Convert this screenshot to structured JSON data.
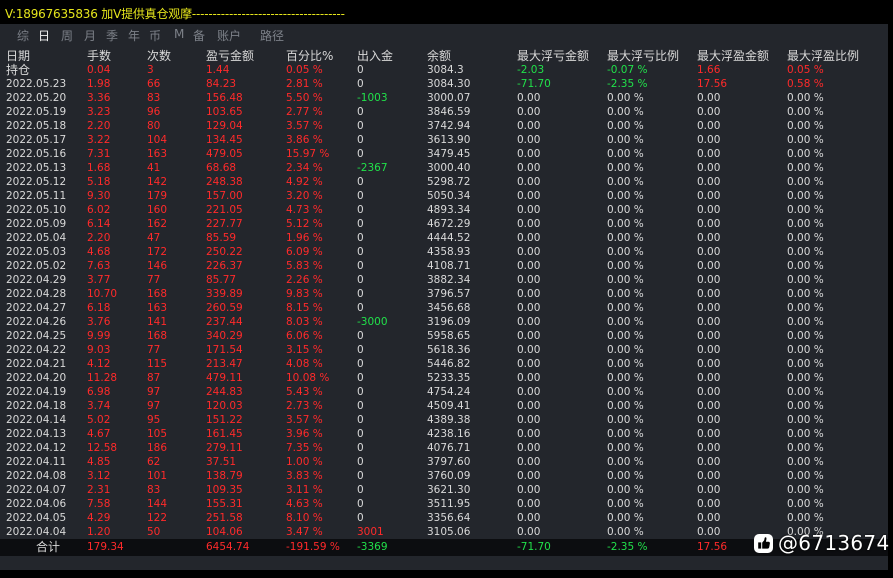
{
  "title": "V:18967635836 加V提供真仓观摩-------------------------------------",
  "tabs": [
    {
      "label": "综",
      "active": false
    },
    {
      "label": "日",
      "active": true
    },
    {
      "label": "周",
      "active": false
    },
    {
      "label": "月",
      "active": false
    },
    {
      "label": "季",
      "active": false
    },
    {
      "label": "年",
      "active": false
    },
    {
      "label": "币",
      "active": false
    },
    {
      "label": "M",
      "active": false
    },
    {
      "label": "备",
      "active": false
    },
    {
      "label": "账户",
      "active": false
    },
    {
      "label": "路径",
      "active": false
    }
  ],
  "columns": [
    "日期",
    "手数",
    "次数",
    "盈亏金额",
    "百分比%",
    "出入金",
    "余额",
    "最大浮亏金额",
    "最大浮亏比例",
    "最大浮盈金额",
    "最大浮盈比例"
  ],
  "colors": {
    "positive": "#ff2a2a",
    "negative": "#21e04a",
    "neutral": "#d9d9d9",
    "title": "#e6e61c"
  },
  "rows": [
    [
      "持仓",
      "0.04",
      "3",
      "1.44",
      "0.05 %",
      "0",
      "3084.3",
      "-2.03",
      "-0.07 %",
      "1.66",
      "0.05 %"
    ],
    [
      "2022.05.23",
      "1.98",
      "66",
      "84.23",
      "2.81 %",
      "0",
      "3084.30",
      "-71.70",
      "-2.35 %",
      "17.56",
      "0.58 %"
    ],
    [
      "2022.05.20",
      "3.36",
      "83",
      "156.48",
      "5.50 %",
      "-1003",
      "3000.07",
      "0.00",
      "0.00 %",
      "0.00",
      "0.00 %"
    ],
    [
      "2022.05.19",
      "3.23",
      "96",
      "103.65",
      "2.77 %",
      "0",
      "3846.59",
      "0.00",
      "0.00 %",
      "0.00",
      "0.00 %"
    ],
    [
      "2022.05.18",
      "2.20",
      "80",
      "129.04",
      "3.57 %",
      "0",
      "3742.94",
      "0.00",
      "0.00 %",
      "0.00",
      "0.00 %"
    ],
    [
      "2022.05.17",
      "3.22",
      "104",
      "134.45",
      "3.86 %",
      "0",
      "3613.90",
      "0.00",
      "0.00 %",
      "0.00",
      "0.00 %"
    ],
    [
      "2022.05.16",
      "7.31",
      "163",
      "479.05",
      "15.97 %",
      "0",
      "3479.45",
      "0.00",
      "0.00 %",
      "0.00",
      "0.00 %"
    ],
    [
      "2022.05.13",
      "1.68",
      "41",
      "68.68",
      "2.34 %",
      "-2367",
      "3000.40",
      "0.00",
      "0.00 %",
      "0.00",
      "0.00 %"
    ],
    [
      "2022.05.12",
      "5.18",
      "142",
      "248.38",
      "4.92 %",
      "0",
      "5298.72",
      "0.00",
      "0.00 %",
      "0.00",
      "0.00 %"
    ],
    [
      "2022.05.11",
      "9.30",
      "179",
      "157.00",
      "3.20 %",
      "0",
      "5050.34",
      "0.00",
      "0.00 %",
      "0.00",
      "0.00 %"
    ],
    [
      "2022.05.10",
      "6.02",
      "160",
      "221.05",
      "4.73 %",
      "0",
      "4893.34",
      "0.00",
      "0.00 %",
      "0.00",
      "0.00 %"
    ],
    [
      "2022.05.09",
      "6.14",
      "162",
      "227.77",
      "5.12 %",
      "0",
      "4672.29",
      "0.00",
      "0.00 %",
      "0.00",
      "0.00 %"
    ],
    [
      "2022.05.04",
      "2.20",
      "47",
      "85.59",
      "1.96 %",
      "0",
      "4444.52",
      "0.00",
      "0.00 %",
      "0.00",
      "0.00 %"
    ],
    [
      "2022.05.03",
      "4.68",
      "172",
      "250.22",
      "6.09 %",
      "0",
      "4358.93",
      "0.00",
      "0.00 %",
      "0.00",
      "0.00 %"
    ],
    [
      "2022.05.02",
      "7.63",
      "146",
      "226.37",
      "5.83 %",
      "0",
      "4108.71",
      "0.00",
      "0.00 %",
      "0.00",
      "0.00 %"
    ],
    [
      "2022.04.29",
      "3.77",
      "77",
      "85.77",
      "2.26 %",
      "0",
      "3882.34",
      "0.00",
      "0.00 %",
      "0.00",
      "0.00 %"
    ],
    [
      "2022.04.28",
      "10.70",
      "168",
      "339.89",
      "9.83 %",
      "0",
      "3796.57",
      "0.00",
      "0.00 %",
      "0.00",
      "0.00 %"
    ],
    [
      "2022.04.27",
      "6.18",
      "163",
      "260.59",
      "8.15 %",
      "0",
      "3456.68",
      "0.00",
      "0.00 %",
      "0.00",
      "0.00 %"
    ],
    [
      "2022.04.26",
      "3.76",
      "141",
      "237.44",
      "8.03 %",
      "-3000",
      "3196.09",
      "0.00",
      "0.00 %",
      "0.00",
      "0.00 %"
    ],
    [
      "2022.04.25",
      "9.99",
      "168",
      "340.29",
      "6.06 %",
      "0",
      "5958.65",
      "0.00",
      "0.00 %",
      "0.00",
      "0.00 %"
    ],
    [
      "2022.04.22",
      "9.03",
      "77",
      "171.54",
      "3.15 %",
      "0",
      "5618.36",
      "0.00",
      "0.00 %",
      "0.00",
      "0.00 %"
    ],
    [
      "2022.04.21",
      "4.12",
      "115",
      "213.47",
      "4.08 %",
      "0",
      "5446.82",
      "0.00",
      "0.00 %",
      "0.00",
      "0.00 %"
    ],
    [
      "2022.04.20",
      "11.28",
      "87",
      "479.11",
      "10.08 %",
      "0",
      "5233.35",
      "0.00",
      "0.00 %",
      "0.00",
      "0.00 %"
    ],
    [
      "2022.04.19",
      "6.98",
      "97",
      "244.83",
      "5.43 %",
      "0",
      "4754.24",
      "0.00",
      "0.00 %",
      "0.00",
      "0.00 %"
    ],
    [
      "2022.04.18",
      "3.74",
      "97",
      "120.03",
      "2.73 %",
      "0",
      "4509.41",
      "0.00",
      "0.00 %",
      "0.00",
      "0.00 %"
    ],
    [
      "2022.04.14",
      "5.02",
      "95",
      "151.22",
      "3.57 %",
      "0",
      "4389.38",
      "0.00",
      "0.00 %",
      "0.00",
      "0.00 %"
    ],
    [
      "2022.04.13",
      "4.67",
      "105",
      "161.45",
      "3.96 %",
      "0",
      "4238.16",
      "0.00",
      "0.00 %",
      "0.00",
      "0.00 %"
    ],
    [
      "2022.04.12",
      "12.58",
      "186",
      "279.11",
      "7.35 %",
      "0",
      "4076.71",
      "0.00",
      "0.00 %",
      "0.00",
      "0.00 %"
    ],
    [
      "2022.04.11",
      "4.85",
      "62",
      "37.51",
      "1.00 %",
      "0",
      "3797.60",
      "0.00",
      "0.00 %",
      "0.00",
      "0.00 %"
    ],
    [
      "2022.04.08",
      "3.12",
      "101",
      "138.79",
      "3.83 %",
      "0",
      "3760.09",
      "0.00",
      "0.00 %",
      "0.00",
      "0.00 %"
    ],
    [
      "2022.04.07",
      "2.31",
      "83",
      "109.35",
      "3.11 %",
      "0",
      "3621.30",
      "0.00",
      "0.00 %",
      "0.00",
      "0.00 %"
    ],
    [
      "2022.04.06",
      "7.58",
      "144",
      "155.31",
      "4.63 %",
      "0",
      "3511.95",
      "0.00",
      "0.00 %",
      "0.00",
      "0.00 %"
    ],
    [
      "2022.04.05",
      "4.29",
      "122",
      "251.58",
      "8.10 %",
      "0",
      "3356.64",
      "0.00",
      "0.00 %",
      "0.00",
      "0.00 %"
    ],
    [
      "2022.04.04",
      "1.20",
      "50",
      "104.06",
      "3.47 %",
      "3001",
      "3105.06",
      "0.00",
      "0.00 %",
      "0.00",
      "0.00 %"
    ]
  ],
  "total": [
    "合计",
    "179.34",
    "",
    "6454.74",
    "-191.59 %",
    "-3369",
    "",
    "-71.70",
    "-2.35 %",
    "17.56",
    ""
  ],
  "watermark": {
    "text": "@6713674",
    "icon": "facebook-like-icon"
  }
}
